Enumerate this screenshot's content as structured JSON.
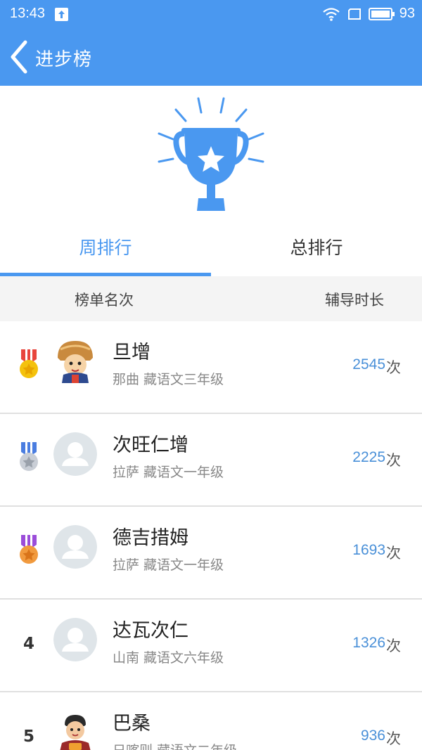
{
  "status_bar": {
    "time": "13:43",
    "battery": "93"
  },
  "nav": {
    "title": "进步榜"
  },
  "tabs": {
    "week": "周排行",
    "total": "总排行"
  },
  "columns": {
    "rank": "榜单名次",
    "duration": "辅导时长"
  },
  "colors": {
    "accent": "#4a98f0"
  },
  "ranking": [
    {
      "rank": "1",
      "name": "旦增",
      "subtitle": "那曲 藏语文三年级",
      "count": "2545",
      "unit": "次",
      "medal": "gold-medal-icon"
    },
    {
      "rank": "2",
      "name": "次旺仁增",
      "subtitle": "拉萨 藏语文一年级",
      "count": "2225",
      "unit": "次",
      "medal": "silver-medal-icon"
    },
    {
      "rank": "3",
      "name": "德吉措姆",
      "subtitle": "拉萨 藏语文一年级",
      "count": "1693",
      "unit": "次",
      "medal": "bronze-medal-icon"
    },
    {
      "rank": "4",
      "name": "达瓦次仁",
      "subtitle": "山南 藏语文六年级",
      "count": "1326",
      "unit": "次"
    },
    {
      "rank": "5",
      "name": "巴桑",
      "subtitle": "日喀则 藏语文二年级",
      "count": "936",
      "unit": "次"
    }
  ]
}
